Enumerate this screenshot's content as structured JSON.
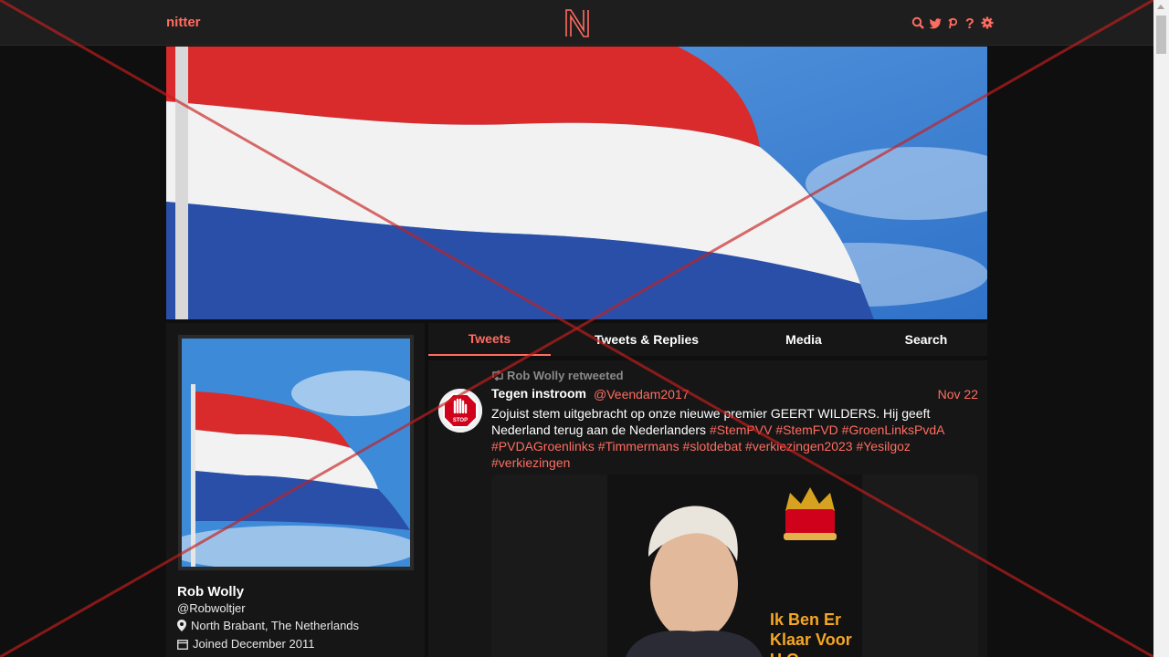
{
  "nav": {
    "brand": "nitter",
    "icons": [
      "search-icon",
      "twitter-icon",
      "rss-icon",
      "help-icon",
      "settings-icon"
    ]
  },
  "colors": {
    "accent": "#ff6c60",
    "nav_bg": "#1e1e1e",
    "card_bg": "#161616",
    "page_bg": "#0f0f0f"
  },
  "profile": {
    "fullname": "Rob Wolly",
    "username": "@Robwoltjer",
    "location": "North Brabant, The Netherlands",
    "joined": "Joined December 2011"
  },
  "tabs": [
    {
      "label": "Tweets",
      "active": true
    },
    {
      "label": "Tweets & Replies",
      "active": false
    },
    {
      "label": "Media",
      "active": false
    },
    {
      "label": "Search",
      "active": false
    }
  ],
  "tweet": {
    "retweet_header": "Rob Wolly retweeted",
    "name": "Tegen instroom",
    "handle": "@Veendam2017",
    "date": "Nov 22",
    "text": "Zojuist stem uitgebracht op onze nieuwe premier GEERT WILDERS. Hij geeft Nederland terug aan de Nederlanders",
    "hashtags": [
      "#StemPVV",
      "#StemFVD",
      "#GroenLinksPvdA",
      "#PVDAGroenlinks",
      "#Timmermans",
      "#slotdebat",
      "#verkiezingen2023",
      "#Yesilgoz",
      "#verkiezingen"
    ],
    "avatar_label": "STOP",
    "media_caption_line1": "Ik Ben Er",
    "media_caption_line2": "Klaar Voor",
    "media_caption_line3": "U O..."
  }
}
